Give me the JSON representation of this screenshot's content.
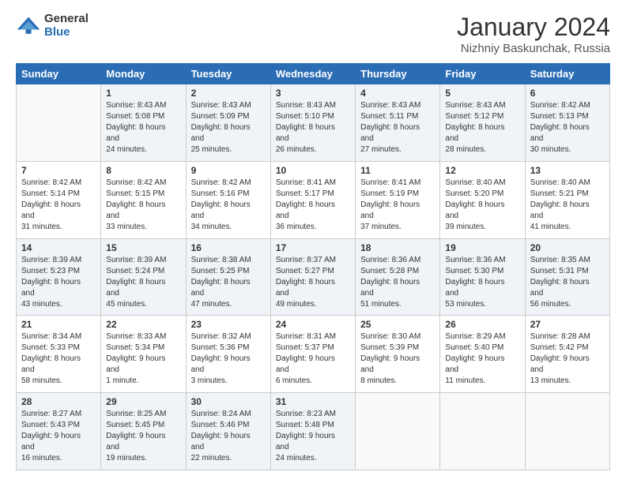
{
  "logo": {
    "general": "General",
    "blue": "Blue"
  },
  "header": {
    "title": "January 2024",
    "location": "Nizhniy Baskunchak, Russia"
  },
  "weekdays": [
    "Sunday",
    "Monday",
    "Tuesday",
    "Wednesday",
    "Thursday",
    "Friday",
    "Saturday"
  ],
  "weeks": [
    [
      {
        "day": "",
        "sunrise": "",
        "sunset": "",
        "daylight": ""
      },
      {
        "day": "1",
        "sunrise": "8:43 AM",
        "sunset": "5:08 PM",
        "daylight": "8 hours and 24 minutes."
      },
      {
        "day": "2",
        "sunrise": "8:43 AM",
        "sunset": "5:09 PM",
        "daylight": "8 hours and 25 minutes."
      },
      {
        "day": "3",
        "sunrise": "8:43 AM",
        "sunset": "5:10 PM",
        "daylight": "8 hours and 26 minutes."
      },
      {
        "day": "4",
        "sunrise": "8:43 AM",
        "sunset": "5:11 PM",
        "daylight": "8 hours and 27 minutes."
      },
      {
        "day": "5",
        "sunrise": "8:43 AM",
        "sunset": "5:12 PM",
        "daylight": "8 hours and 28 minutes."
      },
      {
        "day": "6",
        "sunrise": "8:42 AM",
        "sunset": "5:13 PM",
        "daylight": "8 hours and 30 minutes."
      }
    ],
    [
      {
        "day": "7",
        "sunrise": "8:42 AM",
        "sunset": "5:14 PM",
        "daylight": "8 hours and 31 minutes."
      },
      {
        "day": "8",
        "sunrise": "8:42 AM",
        "sunset": "5:15 PM",
        "daylight": "8 hours and 33 minutes."
      },
      {
        "day": "9",
        "sunrise": "8:42 AM",
        "sunset": "5:16 PM",
        "daylight": "8 hours and 34 minutes."
      },
      {
        "day": "10",
        "sunrise": "8:41 AM",
        "sunset": "5:17 PM",
        "daylight": "8 hours and 36 minutes."
      },
      {
        "day": "11",
        "sunrise": "8:41 AM",
        "sunset": "5:19 PM",
        "daylight": "8 hours and 37 minutes."
      },
      {
        "day": "12",
        "sunrise": "8:40 AM",
        "sunset": "5:20 PM",
        "daylight": "8 hours and 39 minutes."
      },
      {
        "day": "13",
        "sunrise": "8:40 AM",
        "sunset": "5:21 PM",
        "daylight": "8 hours and 41 minutes."
      }
    ],
    [
      {
        "day": "14",
        "sunrise": "8:39 AM",
        "sunset": "5:23 PM",
        "daylight": "8 hours and 43 minutes."
      },
      {
        "day": "15",
        "sunrise": "8:39 AM",
        "sunset": "5:24 PM",
        "daylight": "8 hours and 45 minutes."
      },
      {
        "day": "16",
        "sunrise": "8:38 AM",
        "sunset": "5:25 PM",
        "daylight": "8 hours and 47 minutes."
      },
      {
        "day": "17",
        "sunrise": "8:37 AM",
        "sunset": "5:27 PM",
        "daylight": "8 hours and 49 minutes."
      },
      {
        "day": "18",
        "sunrise": "8:36 AM",
        "sunset": "5:28 PM",
        "daylight": "8 hours and 51 minutes."
      },
      {
        "day": "19",
        "sunrise": "8:36 AM",
        "sunset": "5:30 PM",
        "daylight": "8 hours and 53 minutes."
      },
      {
        "day": "20",
        "sunrise": "8:35 AM",
        "sunset": "5:31 PM",
        "daylight": "8 hours and 56 minutes."
      }
    ],
    [
      {
        "day": "21",
        "sunrise": "8:34 AM",
        "sunset": "5:33 PM",
        "daylight": "8 hours and 58 minutes."
      },
      {
        "day": "22",
        "sunrise": "8:33 AM",
        "sunset": "5:34 PM",
        "daylight": "9 hours and 1 minute."
      },
      {
        "day": "23",
        "sunrise": "8:32 AM",
        "sunset": "5:36 PM",
        "daylight": "9 hours and 3 minutes."
      },
      {
        "day": "24",
        "sunrise": "8:31 AM",
        "sunset": "5:37 PM",
        "daylight": "9 hours and 6 minutes."
      },
      {
        "day": "25",
        "sunrise": "8:30 AM",
        "sunset": "5:39 PM",
        "daylight": "9 hours and 8 minutes."
      },
      {
        "day": "26",
        "sunrise": "8:29 AM",
        "sunset": "5:40 PM",
        "daylight": "9 hours and 11 minutes."
      },
      {
        "day": "27",
        "sunrise": "8:28 AM",
        "sunset": "5:42 PM",
        "daylight": "9 hours and 13 minutes."
      }
    ],
    [
      {
        "day": "28",
        "sunrise": "8:27 AM",
        "sunset": "5:43 PM",
        "daylight": "9 hours and 16 minutes."
      },
      {
        "day": "29",
        "sunrise": "8:25 AM",
        "sunset": "5:45 PM",
        "daylight": "9 hours and 19 minutes."
      },
      {
        "day": "30",
        "sunrise": "8:24 AM",
        "sunset": "5:46 PM",
        "daylight": "9 hours and 22 minutes."
      },
      {
        "day": "31",
        "sunrise": "8:23 AM",
        "sunset": "5:48 PM",
        "daylight": "9 hours and 24 minutes."
      },
      {
        "day": "",
        "sunrise": "",
        "sunset": "",
        "daylight": ""
      },
      {
        "day": "",
        "sunrise": "",
        "sunset": "",
        "daylight": ""
      },
      {
        "day": "",
        "sunrise": "",
        "sunset": "",
        "daylight": ""
      }
    ]
  ]
}
